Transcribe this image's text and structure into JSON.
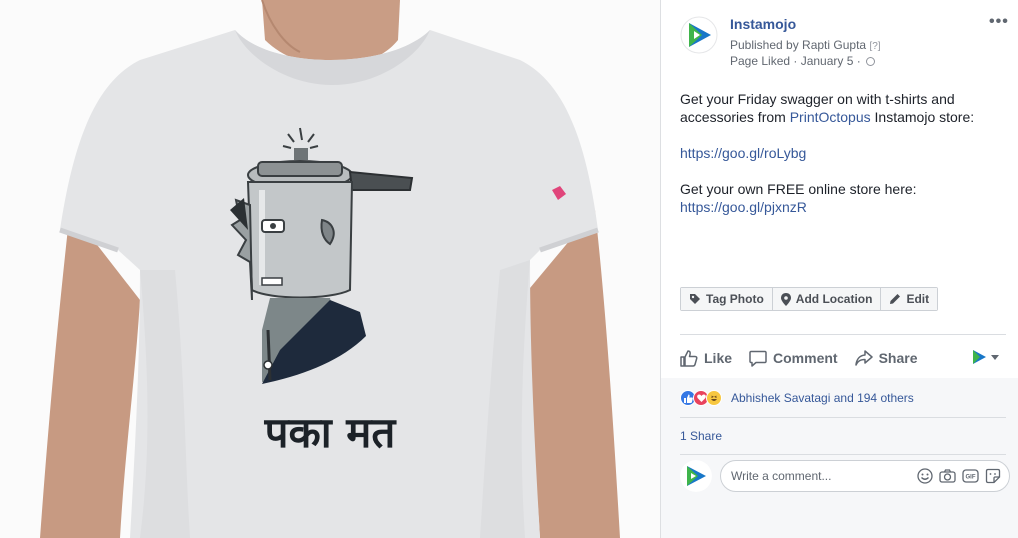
{
  "photo": {
    "shirt_text": "पका मत"
  },
  "post": {
    "page_name": "Instamojo",
    "published_by": "Published by Rapti Gupta",
    "help_marker": "[?]",
    "meta": "Page Liked · January 5 ·",
    "more_label": "•••",
    "text": {
      "line1": "Get your Friday swagger on with t-shirts and",
      "line2_prefix": "accessories from ",
      "line2_link": "PrintOctopus",
      "line2_suffix": " Instamojo store:",
      "link1": "https://goo.gl/roLybg",
      "line3": "Get your own FREE online store here:",
      "link2": "https://goo.gl/pjxnzR"
    }
  },
  "photo_actions": {
    "tag": "Tag Photo",
    "location": "Add Location",
    "edit": "Edit"
  },
  "actions": {
    "like": "Like",
    "comment": "Comment",
    "share": "Share"
  },
  "reactions": {
    "names": "Abhishek Savatagi and 194 others",
    "icons": [
      "like-reaction-icon",
      "love-reaction-icon",
      "haha-reaction-icon"
    ]
  },
  "shares": {
    "count": "1 Share"
  },
  "comment": {
    "placeholder": "Write a comment..."
  },
  "colors": {
    "link": "#365899",
    "brand_blue": "#1877c8",
    "brand_green": "#3fb44b",
    "like_blue": "#3578e5",
    "love_red": "#e9435d",
    "haha_yellow": "#f7c740"
  }
}
